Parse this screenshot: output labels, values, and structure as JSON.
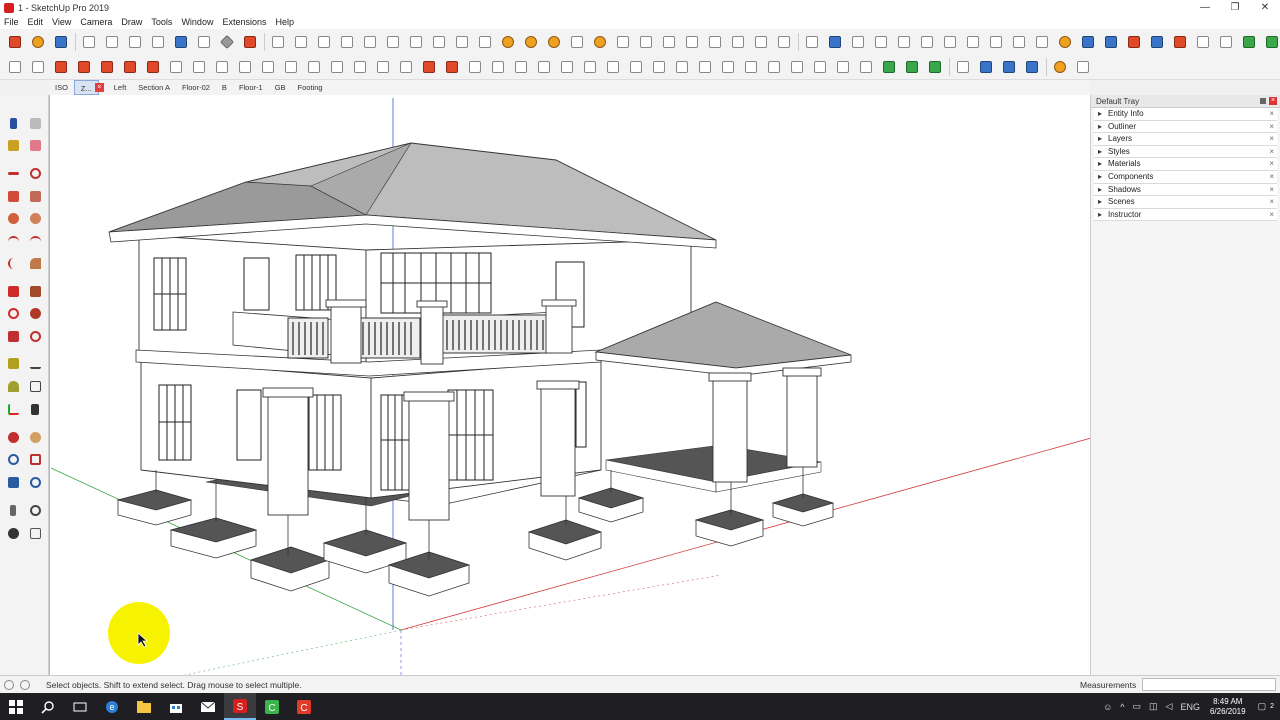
{
  "window": {
    "title": "1 - SketchUp Pro 2019",
    "controls": [
      "—",
      "❐",
      "✕"
    ]
  },
  "menu": [
    "File",
    "Edit",
    "View",
    "Camera",
    "Draw",
    "Tools",
    "Window",
    "Extensions",
    "Help"
  ],
  "scenes": {
    "tabs": [
      "ISO",
      "Z...",
      "Left",
      "Section A",
      "Floor-02",
      "B",
      "Floor-1",
      "GB",
      "Footing"
    ]
  },
  "tray": {
    "title": "Default Tray",
    "panels": [
      "Entity Info",
      "Outliner",
      "Layers",
      "Styles",
      "Materials",
      "Components",
      "Shadows",
      "Scenes",
      "Instructor"
    ]
  },
  "status": {
    "message": "Select objects. Shift to extend select. Drag mouse to select multiple.",
    "measurements_label": "Measurements",
    "measurements_value": ""
  },
  "taskbar": {
    "lang": "ENG",
    "time": "8:49 AM",
    "date": "6/26/2019",
    "notif_count": "2"
  },
  "colors": {
    "axis_red": "#d23c3c",
    "axis_green": "#3aa64a",
    "axis_blue": "#3c5ad2",
    "cursor_highlight": "#f7f300"
  }
}
